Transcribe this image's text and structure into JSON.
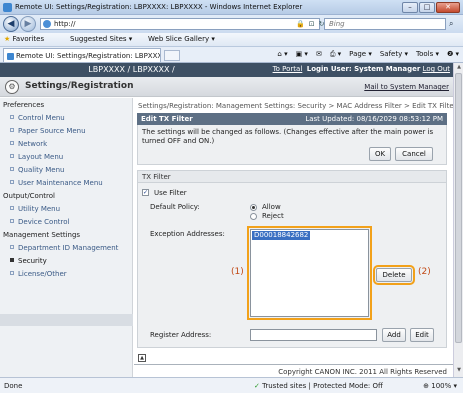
{
  "window": {
    "title": "Remote UI: Settings/Registration: LBPXXXX: LBPXXXX - Windows Internet Explorer",
    "buttons": {
      "minimize": "–",
      "maximize": "□",
      "close": "✕"
    }
  },
  "navbar": {
    "back_icon": "◀",
    "forward_icon": "▶",
    "url": "http://",
    "addr_icons": [
      "🔒",
      "⊡",
      "↻",
      "✕"
    ],
    "search_placeholder": "Bing",
    "search_icon": "⌕"
  },
  "favorites": {
    "label": "Favorites",
    "items": [
      "Suggested Sites ▾",
      "Web Slice Gallery ▾"
    ]
  },
  "tab": {
    "label": "Remote UI: Settings/Registration: LBPXXXX: LBPI..."
  },
  "commandbar": {
    "items": [
      "Page ▾",
      "Safety ▾",
      "Tools ▾",
      "❷ ▾"
    ]
  },
  "page": {
    "device_name": "LBPXXXX / LBPXXXX /",
    "top_links": {
      "portal": "To Portal",
      "login": "Login User: System Manager",
      "logout": "Log Out"
    },
    "settings_title": "Settings/Registration",
    "mail_link": "Mail to System Manager"
  },
  "sidebar": {
    "categories": [
      {
        "label": "Preferences",
        "items": [
          "Control Menu",
          "Paper Source Menu",
          "Network",
          "Layout Menu",
          "Quality Menu",
          "User Maintenance Menu"
        ]
      },
      {
        "label": "Output/Control",
        "items": [
          "Utility Menu",
          "Device Control"
        ]
      },
      {
        "label": "Management Settings",
        "items": [
          "Department ID Management",
          "Security",
          "License/Other"
        ]
      }
    ],
    "active_item": "Security"
  },
  "content": {
    "breadcrumb": "Settings/Registration: Management Settings: Security > MAC Address Filter > Edit TX Filter",
    "edit_header": "Edit TX Filter",
    "last_updated": "Last Updated: 08/16/2029 08:53:12 PM",
    "notice": "The settings will be changed as follows. (Changes effective after the main power is turned OFF and ON.)",
    "ok_label": "OK",
    "cancel_label": "Cancel",
    "tx_filter_header": "TX Filter",
    "use_filter_label": "Use Filter",
    "use_filter_checked": true,
    "default_policy_label": "Default Policy:",
    "policy_options": [
      "Allow",
      "Reject"
    ],
    "policy_selected": "Allow",
    "exception_label": "Exception Addresses:",
    "exception_addresses": [
      "D00018842682"
    ],
    "delete_label": "Delete",
    "callout_1": "(1)",
    "callout_2": "(2)",
    "register_label": "Register Address:",
    "register_value": "",
    "add_label": "Add",
    "edit_label": "Edit",
    "backtop_icon": "▲",
    "copyright": "Copyright CANON INC. 2011 All Rights Reserved"
  },
  "statusbar": {
    "status": "Done",
    "zone": "Trusted sites | Protected Mode: Off",
    "zoom": "100%"
  },
  "colors": {
    "accent": "#3e5064",
    "section_bar": "#5d6f84",
    "highlight": "#f2a11a",
    "callout": "#c24a17",
    "selection": "#3a6fc2"
  }
}
